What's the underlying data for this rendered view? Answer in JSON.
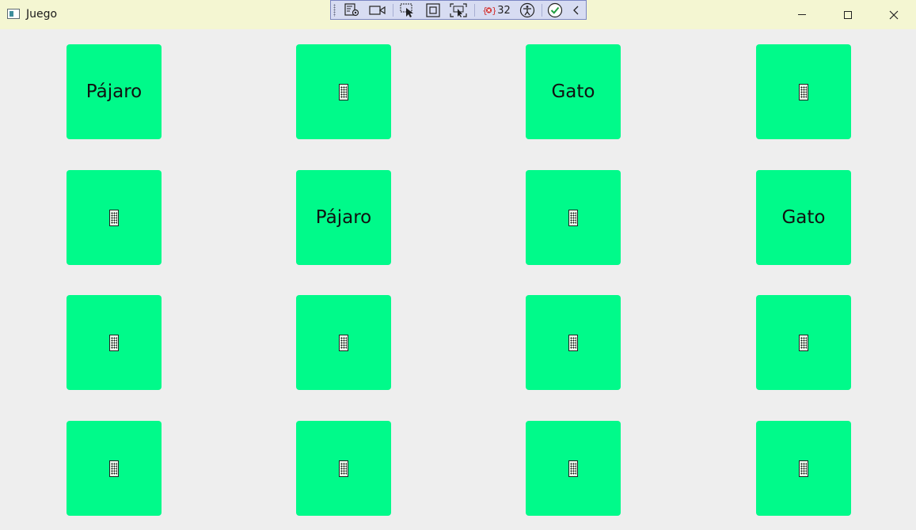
{
  "window": {
    "title": "Juego",
    "icon": "app-window-icon"
  },
  "caption_buttons": [
    "minimize-icon",
    "maximize-icon",
    "close-icon"
  ],
  "dev_toolbar": {
    "binding_failures_count": "32",
    "tools": [
      "live-visual-tree-icon",
      "camera-icon",
      "select-element-icon",
      "display-layout-adorners-icon",
      "track-focus-icon",
      "binding-failures-icon",
      "accessibility-icon",
      "hot-reload-ok-icon",
      "collapse-chevron-icon"
    ]
  },
  "colors": {
    "card": "#00fa8a",
    "background": "#eeeeee",
    "titlebar": "#f4f6d2",
    "toolbar": "#d7dcf2"
  },
  "cards": {
    "r0c0": "Pájaro",
    "r0c2": "Gato",
    "r1c1": "Pájaro",
    "r1c3": "Gato",
    "hidden_glyph": "card-back-icon"
  }
}
